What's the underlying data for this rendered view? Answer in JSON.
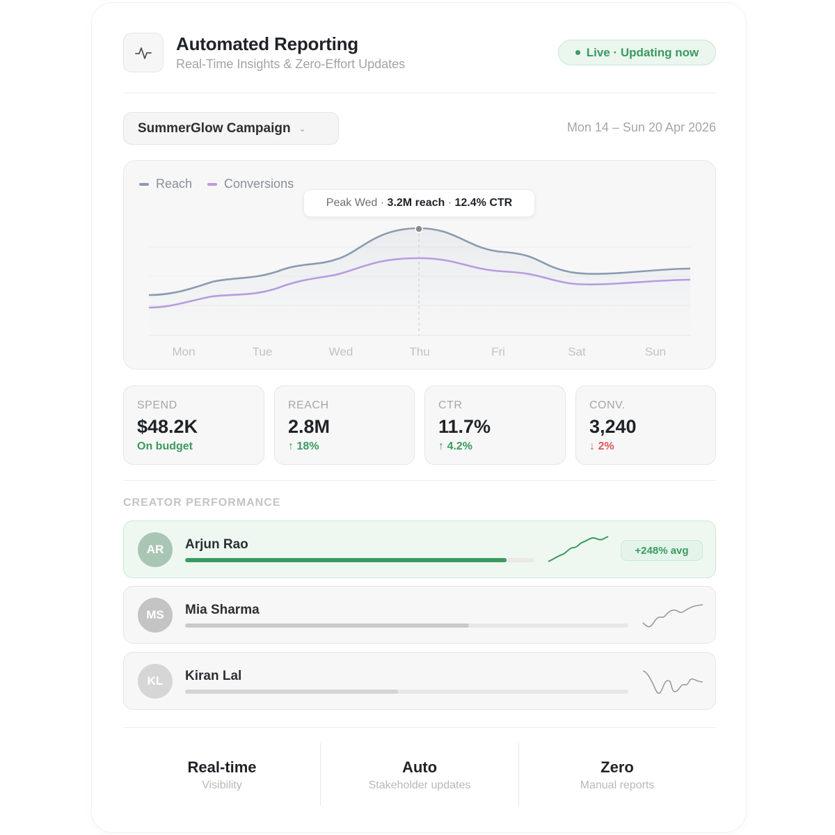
{
  "header": {
    "icon": "activity-pulse-icon",
    "title": "Automated Reporting",
    "subtitle": "Real-Time Insights & Zero-Effort Updates",
    "live_status": "Live · Updating now"
  },
  "toolbar": {
    "campaign": "SummerGlow Campaign",
    "date_range": "Mon 14 – Sun 20 Apr 2026"
  },
  "chart": {
    "legend": [
      {
        "name": "Reach",
        "color": "#8a9bb0"
      },
      {
        "name": "Conversions",
        "color": "#b79be0"
      }
    ],
    "tooltip": {
      "prefix": "Peak Wed ·",
      "reach": "3.2M reach",
      "separator": "·",
      "ctr": "12.4% CTR"
    },
    "days": [
      "Mon",
      "Tue",
      "Wed",
      "Thu",
      "Fri",
      "Sat",
      "Sun"
    ]
  },
  "kpis": [
    {
      "label": "SPEND",
      "value": "$48.2K",
      "delta": "On budget",
      "trend": "neutral"
    },
    {
      "label": "REACH",
      "value": "2.8M",
      "delta": "↑ 18%",
      "trend": "up"
    },
    {
      "label": "CTR",
      "value": "11.7%",
      "delta": "↑ 4.2%",
      "trend": "up"
    },
    {
      "label": "CONV.",
      "value": "3,240",
      "delta": "↓ 2%",
      "trend": "down"
    }
  ],
  "creators": {
    "section_label": "CREATOR PERFORMANCE",
    "rows": [
      {
        "initials": "AR",
        "name": "Arjun Rao",
        "progress": 0.92,
        "badge": "+248% avg",
        "accent": "#3a9a5f"
      },
      {
        "initials": "MS",
        "name": "Mia Sharma",
        "progress": 0.64,
        "accent": "#9a9a9a"
      },
      {
        "initials": "KL",
        "name": "Kiran Lal",
        "progress": 0.48,
        "accent": "#9a9a9a"
      }
    ]
  },
  "footer": [
    {
      "value": "Real-time",
      "label": "Visibility"
    },
    {
      "value": "Auto",
      "label": "Stakeholder updates"
    },
    {
      "value": "Zero",
      "label": "Manual reports"
    }
  ]
}
